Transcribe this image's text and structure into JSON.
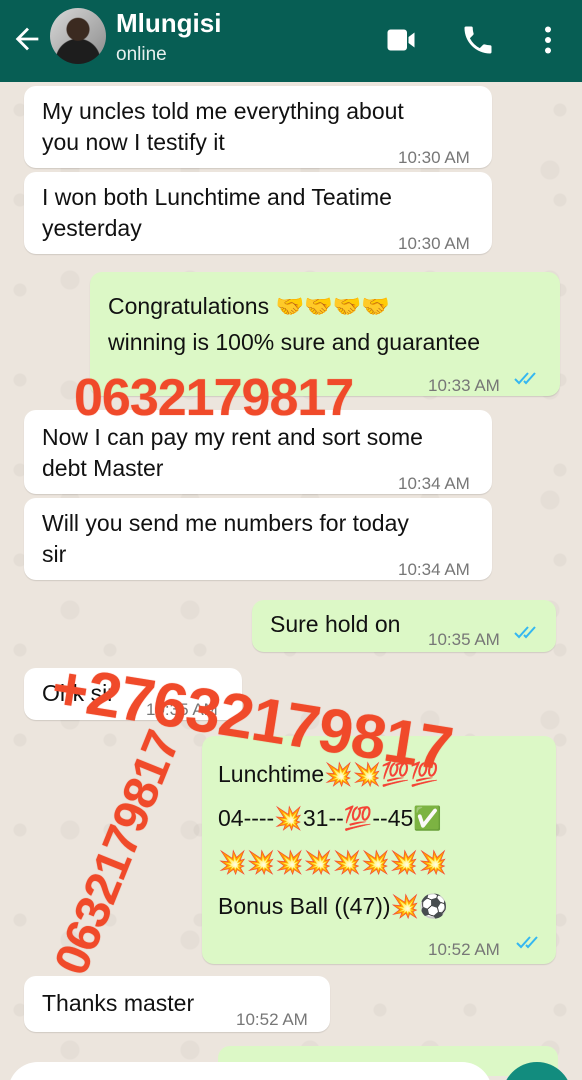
{
  "header": {
    "name": "Mlungisi",
    "status": "online"
  },
  "messages": [
    {
      "dir": "in",
      "text": "My uncles told me everything about\nyou now I testify it",
      "time": "10:30 AM"
    },
    {
      "dir": "in",
      "text": "I won both Lunchtime and Teatime\nyesterday",
      "time": "10:30 AM"
    },
    {
      "dir": "out",
      "text": "Congratulations 🤝🤝🤝🤝\nwinning is 100% sure and guarantee",
      "time": "10:33 AM",
      "read": true
    },
    {
      "dir": "in",
      "text": "Now I can pay my rent and sort some\ndebt Master",
      "time": "10:34 AM"
    },
    {
      "dir": "in",
      "text": "Will you send me numbers for today\nsir",
      "time": "10:34 AM"
    },
    {
      "dir": "out",
      "text": "Sure hold on",
      "time": "10:35 AM",
      "read": true
    },
    {
      "dir": "in",
      "text": "Ohk sir",
      "time": "10:35 AM"
    },
    {
      "dir": "out",
      "text": "Lunchtime💥💥💯💯\n04----💥31--💯--45✅\n💥💥💥💥💥💥💥💥\nBonus Ball ((47))💥⚽",
      "time": "10:52 AM",
      "read": true
    },
    {
      "dir": "in",
      "text": "Thanks master",
      "time": "10:52 AM"
    }
  ],
  "watermarks": {
    "w1": "0632179817",
    "w2": "+27632179817",
    "w3": "0632179817"
  },
  "colors": {
    "header": "#075e54",
    "outgoing_bubble": "#dcf8c6",
    "incoming_bubble": "#ffffff",
    "read_tick": "#34b7f1",
    "watermark": "#f04a2a"
  }
}
